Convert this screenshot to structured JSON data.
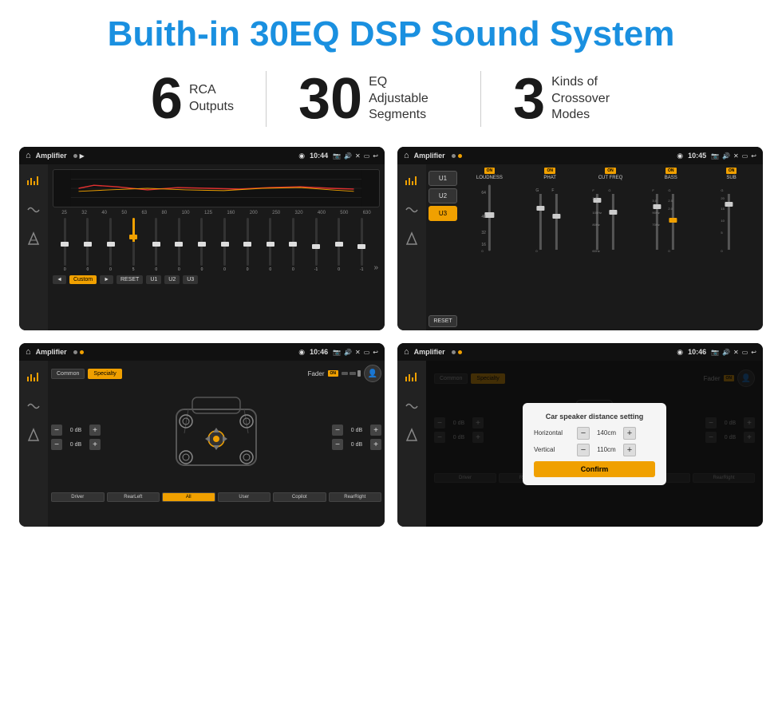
{
  "header": {
    "title": "Buith-in 30EQ DSP Sound System"
  },
  "stats": [
    {
      "number": "6",
      "label": "RCA\nOutputs"
    },
    {
      "number": "30",
      "label": "EQ Adjustable\nSegments"
    },
    {
      "number": "3",
      "label": "Kinds of\nCrossover Modes"
    }
  ],
  "screens": {
    "eq_screen": {
      "app": "Amplifier",
      "time": "10:44",
      "frequencies": [
        "25",
        "32",
        "40",
        "50",
        "63",
        "80",
        "100",
        "125",
        "160",
        "200",
        "250",
        "320",
        "400",
        "500",
        "630"
      ],
      "values": [
        "0",
        "0",
        "0",
        "5",
        "0",
        "0",
        "0",
        "0",
        "0",
        "0",
        "0",
        "-1",
        "0",
        "-1"
      ],
      "preset": "Custom",
      "buttons": [
        "◄",
        "Custom",
        "►",
        "RESET",
        "U1",
        "U2",
        "U3"
      ]
    },
    "dsp_screen": {
      "app": "Amplifier",
      "time": "10:45",
      "presets": [
        "U1",
        "U2",
        "U3"
      ],
      "channels": [
        "LOUDNESS",
        "PHAT",
        "CUT FREQ",
        "BASS",
        "SUB"
      ],
      "reset_label": "RESET"
    },
    "crossover_screen": {
      "app": "Amplifier",
      "time": "10:46",
      "tabs": [
        "Common",
        "Specialty"
      ],
      "fader_label": "Fader",
      "fader_on": "ON",
      "vol_rows": [
        {
          "label": "0 dB"
        },
        {
          "label": "0 dB"
        },
        {
          "label": "0 dB"
        },
        {
          "label": "0 dB"
        }
      ],
      "buttons": [
        "Driver",
        "RearLeft",
        "All",
        "User",
        "Copilot",
        "RearRight"
      ]
    },
    "dialog_screen": {
      "app": "Amplifier",
      "time": "10:46",
      "dialog": {
        "title": "Car speaker distance setting",
        "horizontal_label": "Horizontal",
        "horizontal_value": "140cm",
        "vertical_label": "Vertical",
        "vertical_value": "110cm",
        "confirm_label": "Confirm"
      }
    }
  },
  "icons": {
    "home": "⌂",
    "location": "◉",
    "camera": "📷",
    "volume": "🔊",
    "back": "↩",
    "play": "▶",
    "pause": "⏸",
    "eq_icon": "≡",
    "wave_icon": "〜",
    "speaker_icon": "🔊",
    "arrow_up": "▲",
    "arrow_down": "▼",
    "arrow_left": "◄",
    "arrow_right": "►",
    "person_icon": "👤"
  }
}
